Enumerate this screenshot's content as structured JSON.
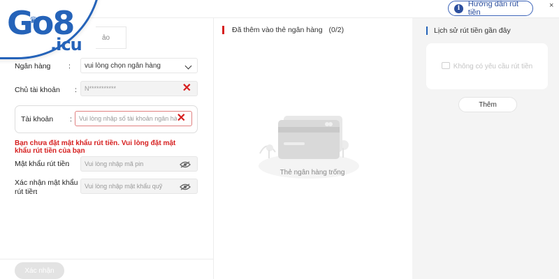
{
  "brand": {
    "logo_main": "Go8",
    "logo_sub": ".icu"
  },
  "header": {
    "guide_label": "Hướng dẫn rút tiền",
    "close_label": "×"
  },
  "partial_tab": {
    "label": "ảo"
  },
  "form": {
    "bank": {
      "label": "Ngân hàng",
      "colon": ":",
      "value": "vui lòng chọn ngân hàng"
    },
    "holder": {
      "label": "Chủ tài khoản",
      "colon": ":",
      "value": "N***********"
    },
    "account": {
      "label": "Tài khoản",
      "colon": ":",
      "placeholder": "Vui lòng nhập số tài khoản ngân hàng"
    },
    "error": "Bạn chưa đặt mật khẩu rút tiền. Vui lòng đặt mật khẩu rút tiền của bạn",
    "pin": {
      "label": "Mật khẩu rút tiền",
      "colon": ":",
      "placeholder": "Vui lòng nhập mã pin"
    },
    "confirm": {
      "label_line1": "Xác nhận mật khẩu",
      "label_line2": "rút tiền",
      "colon": ":",
      "placeholder": "Vui lòng nhập mật khẩu quỹ"
    },
    "submit_label": "Xác nhận"
  },
  "cards": {
    "title": "Đã thêm vào thẻ ngân hàng",
    "count": "(0/2)",
    "empty_text": "Thẻ ngân hàng trống"
  },
  "history": {
    "title": "Lịch sử rút tiền gần đây",
    "empty_text": "Không có yêu cầu rút tiền",
    "add_label": "Thêm"
  },
  "colors": {
    "brand_blue": "#2563b9",
    "error_red": "#d61f1f"
  }
}
